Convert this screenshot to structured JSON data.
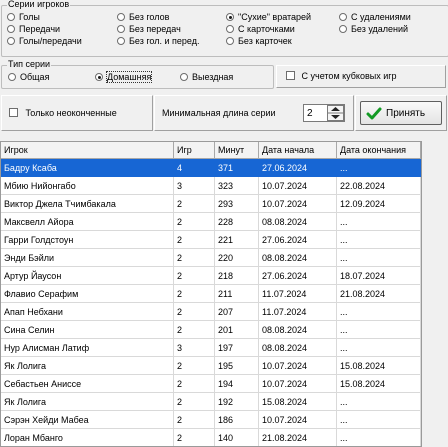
{
  "series_group": {
    "title": "Серии игроков",
    "options": [
      {
        "label": "Голы",
        "selected": false
      },
      {
        "label": "Без голов",
        "selected": false
      },
      {
        "label": "\"Сухие\" вратарей",
        "selected": true
      },
      {
        "label": "С удалениями",
        "selected": false
      },
      {
        "label": "Передачи",
        "selected": false
      },
      {
        "label": "Без передач",
        "selected": false
      },
      {
        "label": "С карточками",
        "selected": false
      },
      {
        "label": "Без удалений",
        "selected": false
      },
      {
        "label": "Голы/передачи",
        "selected": false
      },
      {
        "label": "Без гол. и перед.",
        "selected": false
      },
      {
        "label": "Без карточек",
        "selected": false
      }
    ]
  },
  "type_group": {
    "title": "Тип серии",
    "options": [
      {
        "label": "Общая",
        "selected": false
      },
      {
        "label": "Домашняя",
        "selected": true
      },
      {
        "label": "Выездная",
        "selected": false
      }
    ]
  },
  "cup_checkbox": {
    "label": "С учетом кубковых игр",
    "checked": false
  },
  "unfinished_checkbox": {
    "label": "Только неоконченные",
    "checked": false
  },
  "min_length": {
    "label": "Минимальная длина серии",
    "value": "2"
  },
  "accept_button": {
    "label": "Принять"
  },
  "table": {
    "columns": [
      "Игрок",
      "Игр",
      "Минут",
      "Дата начала",
      "Дата окончания"
    ],
    "selected_row": 0,
    "rows": [
      [
        "Бадру Ксаба",
        "4",
        "371",
        "27.06.2024",
        "..."
      ],
      [
        "Мбию Нийонгабо",
        "3",
        "323",
        "10.07.2024",
        "22.08.2024"
      ],
      [
        "Виктор Джела Тчимбакала",
        "2",
        "293",
        "10.07.2024",
        "12.09.2024"
      ],
      [
        "Максвелл Айора",
        "2",
        "228",
        "08.08.2024",
        "..."
      ],
      [
        "Гарри Голдстоун",
        "2",
        "221",
        "27.06.2024",
        "..."
      ],
      [
        "Энди Бэйли",
        "2",
        "220",
        "08.08.2024",
        "..."
      ],
      [
        "Артур Йаусон",
        "2",
        "218",
        "27.06.2024",
        "18.07.2024"
      ],
      [
        "Флавио Серафим",
        "2",
        "211",
        "11.07.2024",
        "21.08.2024"
      ],
      [
        "Апап Небхани",
        "2",
        "207",
        "11.07.2024",
        "..."
      ],
      [
        "Сина Селин",
        "2",
        "201",
        "08.08.2024",
        "..."
      ],
      [
        "Нур Алисман Латиф",
        "3",
        "197",
        "08.08.2024",
        "..."
      ],
      [
        "Як Лолига",
        "2",
        "195",
        "10.07.2024",
        "15.08.2024"
      ],
      [
        "Себастьен Аниссе",
        "2",
        "194",
        "10.07.2024",
        "15.08.2024"
      ],
      [
        "Як Лолига",
        "2",
        "192",
        "15.08.2024",
        "..."
      ],
      [
        "Сэрэн Хейди Мабеа",
        "2",
        "186",
        "10.07.2024",
        "..."
      ],
      [
        "Лоран Мбанго",
        "2",
        "140",
        "21.08.2024",
        "..."
      ]
    ]
  }
}
